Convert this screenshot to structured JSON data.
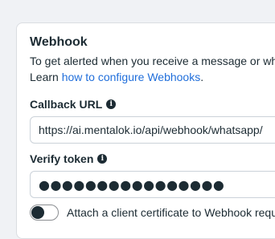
{
  "webhook": {
    "title": "Webhook",
    "description_line1": "To get alerted when you receive a message or wh",
    "description_line2_prefix": "Learn ",
    "description_link": "how to configure Webhooks",
    "description_line2_suffix": "."
  },
  "callback": {
    "label": "Callback URL",
    "value": "https://ai.mentalok.io/api/webhook/whatsapp/"
  },
  "verify": {
    "label": "Verify token",
    "value": "●●●●●●●●●●●●●●●●"
  },
  "certificate": {
    "label": "Attach a client certificate to Webhook requ",
    "enabled": false
  },
  "colors": {
    "link": "#216fdb",
    "text": "#1c2b33",
    "background": "#f0f2f5"
  },
  "icons": {
    "info": "info-icon"
  }
}
